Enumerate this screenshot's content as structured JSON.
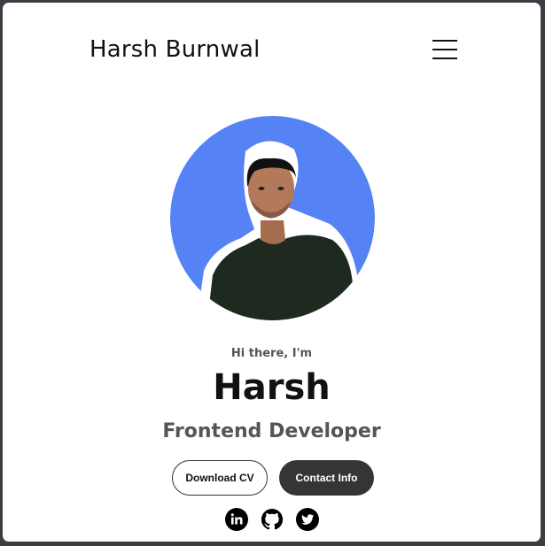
{
  "header": {
    "logo_text": "Harsh Burnwal",
    "menu_icon": "hamburger-menu-icon"
  },
  "profile": {
    "greeting": "Hi there, I'm",
    "name": "Harsh",
    "title": "Frontend Developer",
    "avatar_bg_color": "#5582f5"
  },
  "buttons": {
    "download_cv": "Download CV",
    "contact_info": "Contact Info"
  },
  "socials": [
    {
      "icon": "linkedin-icon"
    },
    {
      "icon": "github-icon"
    },
    {
      "icon": "twitter-icon"
    }
  ]
}
